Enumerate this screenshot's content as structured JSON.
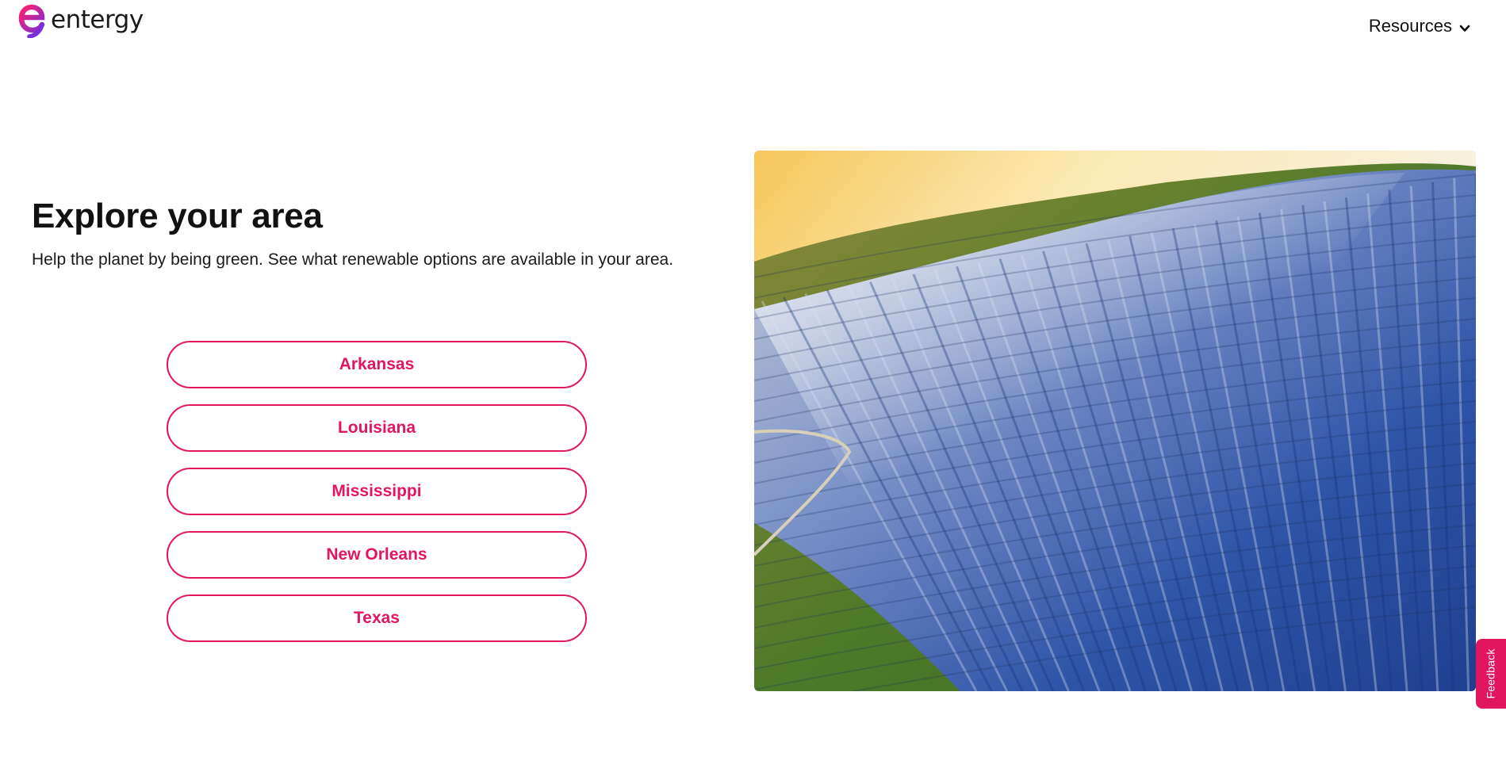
{
  "header": {
    "brand_name": "entergy",
    "resources_label": "Resources"
  },
  "main": {
    "title": "Explore your area",
    "subtitle": "Help the planet by being green. See what renewable options are available in your area.",
    "areas": [
      {
        "label": "Arkansas"
      },
      {
        "label": "Louisiana"
      },
      {
        "label": "Mississippi"
      },
      {
        "label": "New Orleans"
      },
      {
        "label": "Texas"
      }
    ]
  },
  "feedback": {
    "label": "Feedback"
  },
  "colors": {
    "accent": "#e2155f",
    "logo_gradient_start": "#e2155f",
    "logo_gradient_end": "#7b2fd8",
    "text": "#111111"
  },
  "icons": {
    "logo": "entergy-logo-icon",
    "resources_chevron": "chevron-down-icon"
  },
  "image": {
    "subject": "solar-panel-field-photo"
  }
}
